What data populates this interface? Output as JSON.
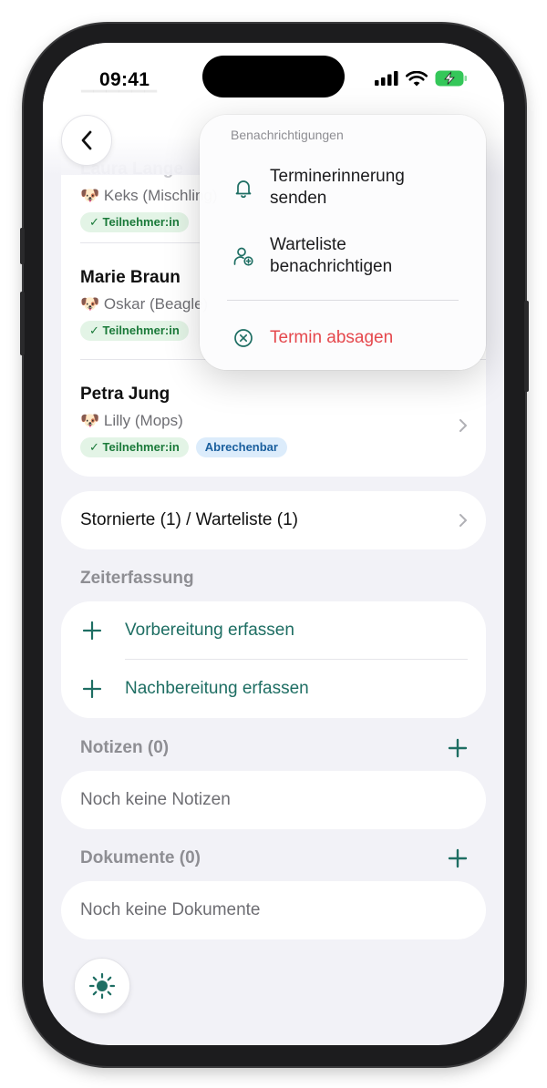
{
  "status_bar": {
    "time": "09:41"
  },
  "header_ghost": {
    "name_behind": "Laura Lange"
  },
  "participants": [
    {
      "name": "Laura Lange",
      "pet": "🐶 Keks (Mischling)",
      "badges": [
        "✓ Teilnehmer:in"
      ]
    },
    {
      "name": "Marie Braun",
      "pet": "🐶 Oskar (Beagle)",
      "badges": [
        "✓ Teilnehmer:in"
      ]
    },
    {
      "name": "Petra Jung",
      "pet": "🐶 Lilly (Mops)",
      "badges": [
        "✓ Teilnehmer:in",
        "Abrechenbar"
      ]
    }
  ],
  "cancelled_row": {
    "label": "Stornierte (1) / Warteliste (1)"
  },
  "time_tracking": {
    "title": "Zeiterfassung",
    "items": [
      "Vorbereitung erfassen",
      "Nachbereitung erfassen"
    ]
  },
  "notes": {
    "title": "Notizen (0)",
    "empty": "Noch keine Notizen"
  },
  "documents": {
    "title": "Dokumente (0)",
    "empty": "Noch keine Dokumente"
  },
  "popup": {
    "header": "Benachrichtigungen",
    "items": [
      {
        "line1": "Terminerinnerung",
        "line2": "senden",
        "icon": "bell-icon"
      },
      {
        "line1": "Warteliste",
        "line2": "benachrichtigen",
        "icon": "person-add-icon"
      },
      {
        "line1": "Termin absagen",
        "line2": "",
        "icon": "x-circle-icon"
      }
    ]
  },
  "colors": {
    "accent": "#1e6e63",
    "danger": "#e5484d",
    "badge_green": "#1b7a3a",
    "badge_blue": "#1a5f9e"
  }
}
